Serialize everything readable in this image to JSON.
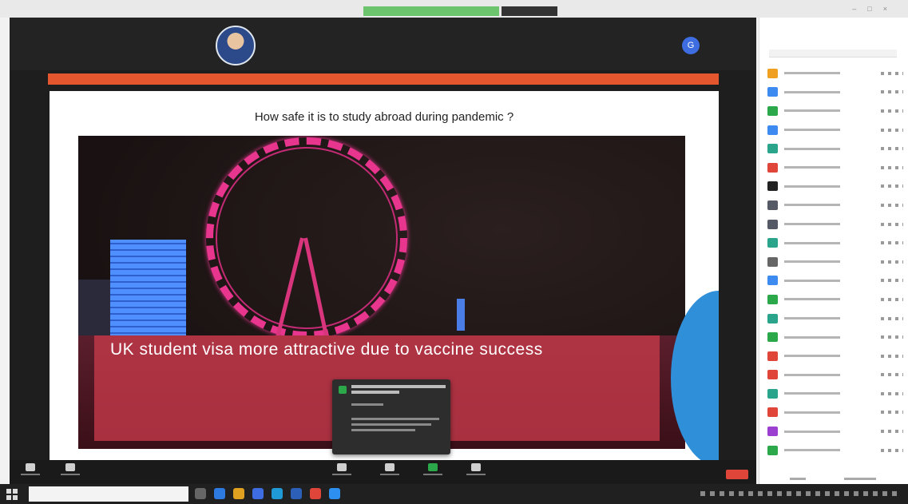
{
  "slide": {
    "title": "How safe it is to study abroad during pandemic ?",
    "caption": "UK student visa more attractive due to vaccine success"
  },
  "participant_avatar_colors": [
    "#f0a020",
    "#3d8bf0",
    "#2ba84a",
    "#3d8bf0",
    "#2aa58c",
    "#e0453a",
    "#222222",
    "#555a66",
    "#555a66",
    "#2aa58c",
    "#666666",
    "#3d8bf0",
    "#2ba84a",
    "#2aa58c",
    "#2ba84a",
    "#e0453a",
    "#e0453a",
    "#2aa58c",
    "#e0453a",
    "#9b3fd0",
    "#2ba84a"
  ],
  "colors": {
    "share_bar": "#e4572e",
    "slide_background": "#ffffff",
    "caption_band": "#c63a4a",
    "avatar_accent": "#3d6de0",
    "end_button": "#e0453a"
  },
  "icons": {
    "avatar_initial": "G"
  }
}
